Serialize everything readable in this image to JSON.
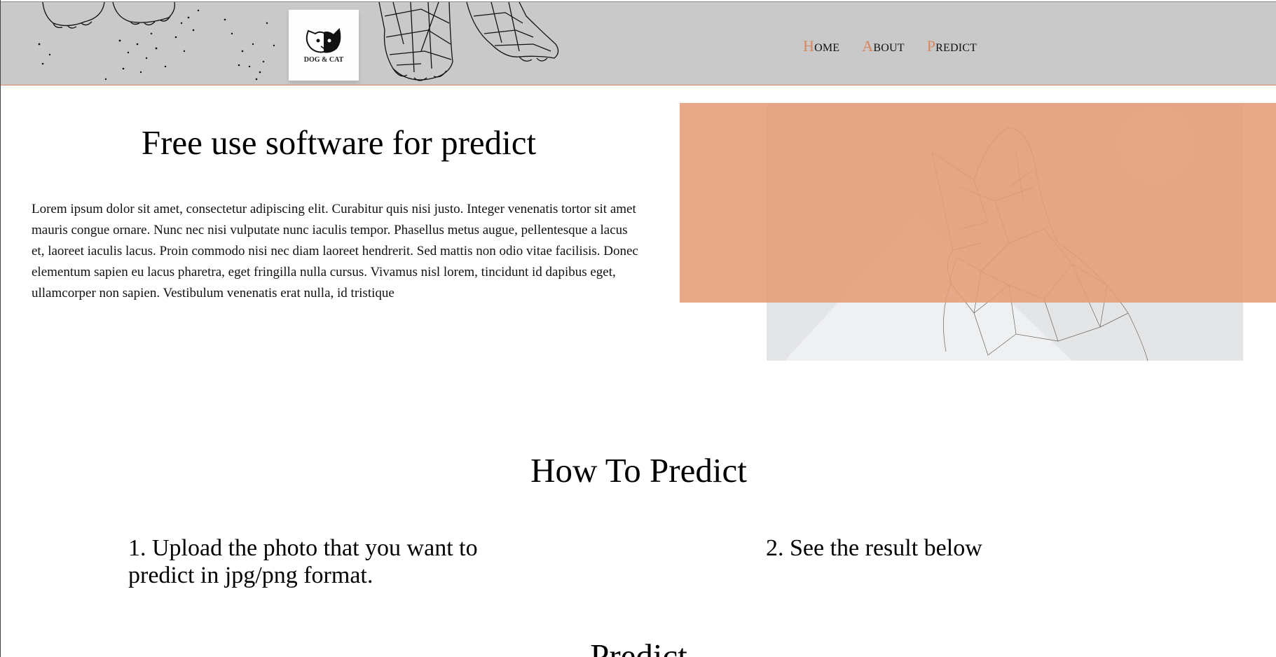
{
  "header": {
    "logo_text": "DOG & CAT",
    "nav": [
      {
        "first": "H",
        "rest": "ome"
      },
      {
        "first": "A",
        "rest": "bout"
      },
      {
        "first": "P",
        "rest": "redict"
      }
    ],
    "accent_color": "#d9855c",
    "background_color": "#c9c9c9"
  },
  "hero": {
    "title": "Free use software for predict",
    "text": "Lorem ipsum dolor sit amet, consectetur adipiscing elit. Curabitur quis nisi justo. Integer venenatis tortor sit amet mauris congue ornare. Nunc nec nisi vulputate nunc iaculis tempor. Phasellus metus augue, pellentesque a lacus et, laoreet iaculis lacus. Proin commodo nisi nec diam laoreet hendrerit. Sed mattis non odio vitae facilisis. Donec elementum sapien eu lacus pharetra, eget fringilla nulla cursus. Vivamus nisl lorem, tincidunt id dapibus eget, ullamcorper non sapien. Vestibulum venenatis erat nulla, id tristique",
    "overlay_color": "#e59d78"
  },
  "how_to": {
    "title": "How To Predict",
    "step1": "1. Upload the photo that you want to predict in jpg/png format.",
    "step2": "2. See the result below"
  },
  "predict": {
    "title": "Predict"
  }
}
